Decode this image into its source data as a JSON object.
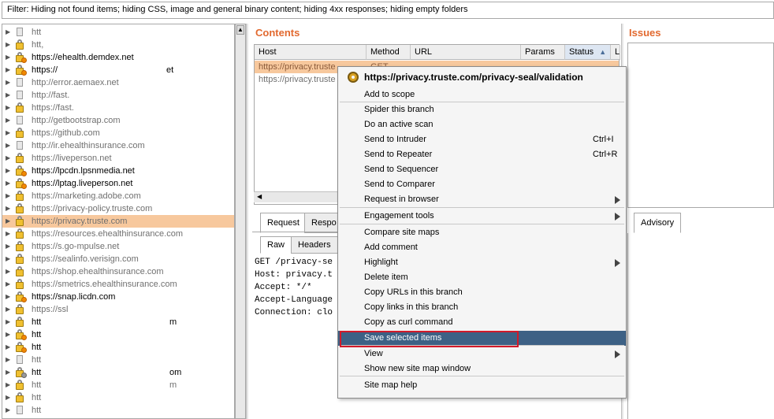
{
  "filter_text": "Filter: Hiding not found items;  hiding CSS, image and general binary content;  hiding 4xx responses;  hiding empty folders",
  "tree": {
    "items": [
      {
        "label": "htt",
        "icon": "page-icon",
        "dim": true
      },
      {
        "label": "htt,",
        "icon": "lock-icon",
        "dim": true
      },
      {
        "label": "https://ehealth.demdex.net",
        "icon": "lock-issue-icon",
        "dim": false
      },
      {
        "label": "https://",
        "icon": "lock-issue-icon",
        "dim": false,
        "tail": "et"
      },
      {
        "label": "http://error.aemaex.net",
        "icon": "page-icon",
        "dim": true
      },
      {
        "label": "http://fast.",
        "icon": "page-icon",
        "dim": true
      },
      {
        "label": "https://fast.",
        "icon": "lock-icon",
        "dim": true
      },
      {
        "label": "http://getbootstrap.com",
        "icon": "page-icon",
        "dim": true
      },
      {
        "label": "https://github.com",
        "icon": "lock-icon",
        "dim": true
      },
      {
        "label": "http://ir.ehealthinsurance.com",
        "icon": "page-icon",
        "dim": true
      },
      {
        "label": "https://liveperson.net",
        "icon": "lock-icon",
        "dim": true
      },
      {
        "label": "https://lpcdn.lpsnmedia.net",
        "icon": "lock-issue-icon",
        "dim": false
      },
      {
        "label": "https://lptag.liveperson.net",
        "icon": "lock-issue-icon",
        "dim": false
      },
      {
        "label": "https://marketing.adobe.com",
        "icon": "lock-icon",
        "dim": true
      },
      {
        "label": "https://privacy-policy.truste.com",
        "icon": "lock-icon",
        "dim": true
      },
      {
        "label": "https://privacy.truste.com",
        "icon": "lock-icon",
        "dim": true,
        "selected": true
      },
      {
        "label": "https://resources.ehealthinsurance.com",
        "icon": "lock-icon",
        "dim": true
      },
      {
        "label": "https://s.go-mpulse.net",
        "icon": "lock-icon",
        "dim": true
      },
      {
        "label": "https://sealinfo.verisign.com",
        "icon": "lock-icon",
        "dim": true
      },
      {
        "label": "https://shop.ehealthinsurance.com",
        "icon": "lock-icon",
        "dim": true
      },
      {
        "label": "https://smetrics.ehealthinsurance.com",
        "icon": "lock-icon",
        "dim": true
      },
      {
        "label": "https://snap.licdn.com",
        "icon": "lock-issue-icon",
        "dim": false
      },
      {
        "label": "https://ssl",
        "icon": "lock-icon",
        "dim": true
      },
      {
        "label": "htt",
        "icon": "lock-icon",
        "dim": false,
        "tail": "m"
      },
      {
        "label": "htt",
        "icon": "lock-issue-icon",
        "dim": false
      },
      {
        "label": "htt",
        "icon": "lock-issue-icon",
        "dim": false
      },
      {
        "label": "htt",
        "icon": "page-icon",
        "dim": true
      },
      {
        "label": "htt",
        "icon": "lock-grey-icon",
        "dim": false,
        "tail": "om"
      },
      {
        "label": "htt",
        "icon": "lock-icon",
        "dim": true,
        "tail": "m"
      },
      {
        "label": "htt",
        "icon": "lock-icon",
        "dim": true
      },
      {
        "label": "htt",
        "icon": "page-icon",
        "dim": true
      }
    ]
  },
  "contents": {
    "title": "Contents",
    "columns": [
      "Host",
      "Method",
      "URL",
      "Params",
      "Status",
      "L"
    ],
    "sort_indicator": "▲",
    "rows": [
      {
        "host": "https://privacy.truste",
        "method": "GET",
        "selected": true
      },
      {
        "host": "https://privacy.truste",
        "method": "",
        "selected": false
      }
    ]
  },
  "issues": {
    "title": "Issues",
    "advisory_tab": "Advisory"
  },
  "request_tabs": {
    "request": "Request",
    "response": "Respo"
  },
  "sub_tabs": {
    "raw": "Raw",
    "headers": "Headers"
  },
  "request_lines": [
    "GET /privacy-se",
    "Host: privacy.t",
    "Accept: */*",
    "Accept-Language",
    "Connection: clo"
  ],
  "context_menu": {
    "header": "https://privacy.truste.com/privacy-seal/validation",
    "items": [
      {
        "label": "Add to scope"
      },
      {
        "label": "Spider this branch"
      },
      {
        "label": "Do an active scan"
      },
      {
        "label": "Send to Intruder",
        "shortcut": "Ctrl+I"
      },
      {
        "label": "Send to Repeater",
        "shortcut": "Ctrl+R"
      },
      {
        "label": "Send to Sequencer"
      },
      {
        "label": "Send to Comparer"
      },
      {
        "label": "Request in browser",
        "submenu": true
      },
      {
        "label": "Engagement tools",
        "submenu": true
      },
      {
        "label": "Compare site maps"
      },
      {
        "label": "Add comment"
      },
      {
        "label": "Highlight",
        "submenu": true
      },
      {
        "label": "Delete item"
      },
      {
        "label": "Copy URLs in this branch"
      },
      {
        "label": "Copy links in this branch"
      },
      {
        "label": "Copy as curl command"
      },
      {
        "label": "Save selected items",
        "highlighted": true
      },
      {
        "label": "View",
        "submenu": true
      },
      {
        "label": "Show new site map window"
      },
      {
        "label": "Site map help"
      }
    ]
  }
}
